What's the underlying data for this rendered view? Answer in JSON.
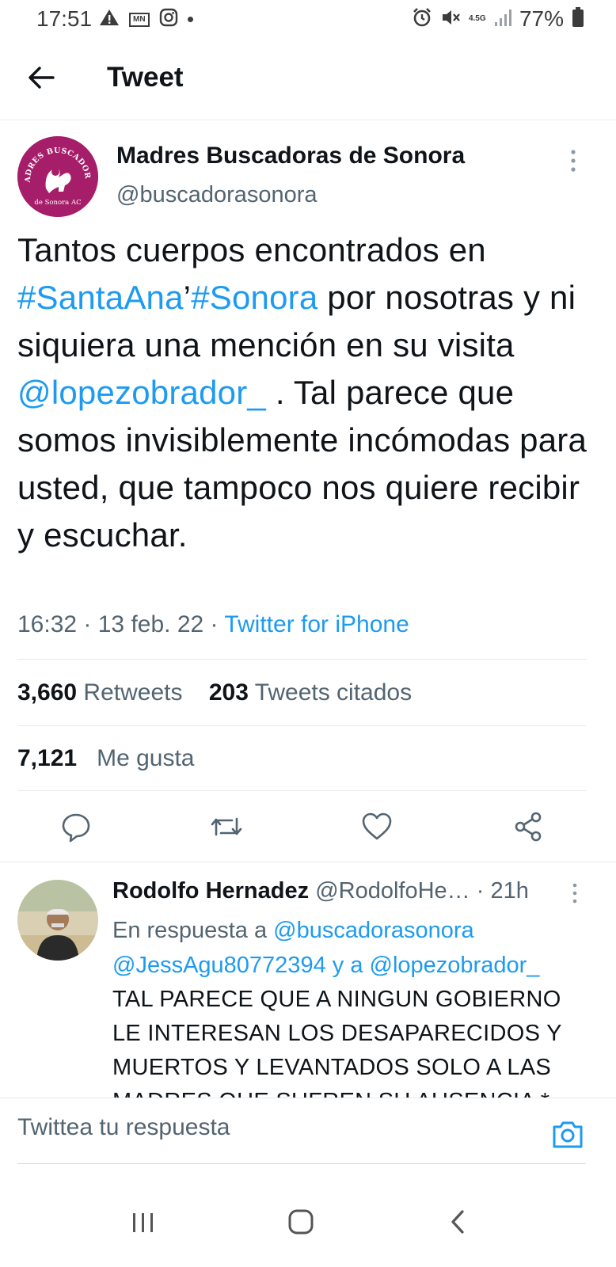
{
  "status_bar": {
    "time": "17:51",
    "network": "4.5G",
    "battery": "77%"
  },
  "header": {
    "title": "Tweet"
  },
  "tweet": {
    "author_name": "Madres Buscadoras de Sonora",
    "author_handle": "@buscadorasonora",
    "text_parts": {
      "p1": "Tantos cuerpos encontrados en ",
      "tag1": "#SantaAna",
      "p2": "’",
      "tag2": "#Sonora",
      "p3": " por nosotras y ni siquiera una mención en su visita ",
      "mention": "@lopezobrador_",
      "p4": " . Tal parece que somos invisiblemente incómodas para usted, que tampoco nos quiere recibir y escuchar."
    },
    "time": "16:32",
    "date": "13 feb. 22",
    "source": "Twitter for iPhone",
    "retweets_count": "3,660",
    "retweets_label": "Retweets",
    "quotes_count": "203",
    "quotes_label": "Tweets citados",
    "likes_count": "7,121",
    "likes_label": "Me gusta"
  },
  "reply": {
    "author_name": "Rodolfo Hernadez",
    "author_handle": "@RodolfoHe…",
    "time": "21h",
    "reply_to_prefix": "En respuesta a ",
    "reply_to_user1": "@buscadorasonora",
    "reply_to_user2": "@JessAgu80772394",
    "reply_to_and": " y a ",
    "reply_to_user3": "@lopezobrador_",
    "text": "TAL PARECE QUE A NINGUN GOBIERNO LE INTERESAN LOS DESAPARECIDOS Y MUERTOS Y LEVANTADOS SOLO A LAS MADRES QUE SUFREN SU AUSENCIA *"
  },
  "compose": {
    "placeholder": "Twittea tu respuesta"
  },
  "avatar_logo": {
    "top_text": "MADRES BUSCADORAS",
    "bottom_text": "de Sonora AC"
  },
  "colors": {
    "link": "#1d9bf0",
    "muted": "#536471",
    "avatar_brand": "#a61e6a"
  },
  "icons": [
    "back-arrow-icon",
    "warning-icon",
    "instagram-icon",
    "alarm-icon",
    "mute-icon",
    "signal-icon",
    "battery-icon",
    "more-vertical-icon",
    "reply-icon",
    "retweet-icon",
    "like-icon",
    "share-icon",
    "camera-icon",
    "recents-icon",
    "home-icon",
    "nav-back-icon"
  ]
}
